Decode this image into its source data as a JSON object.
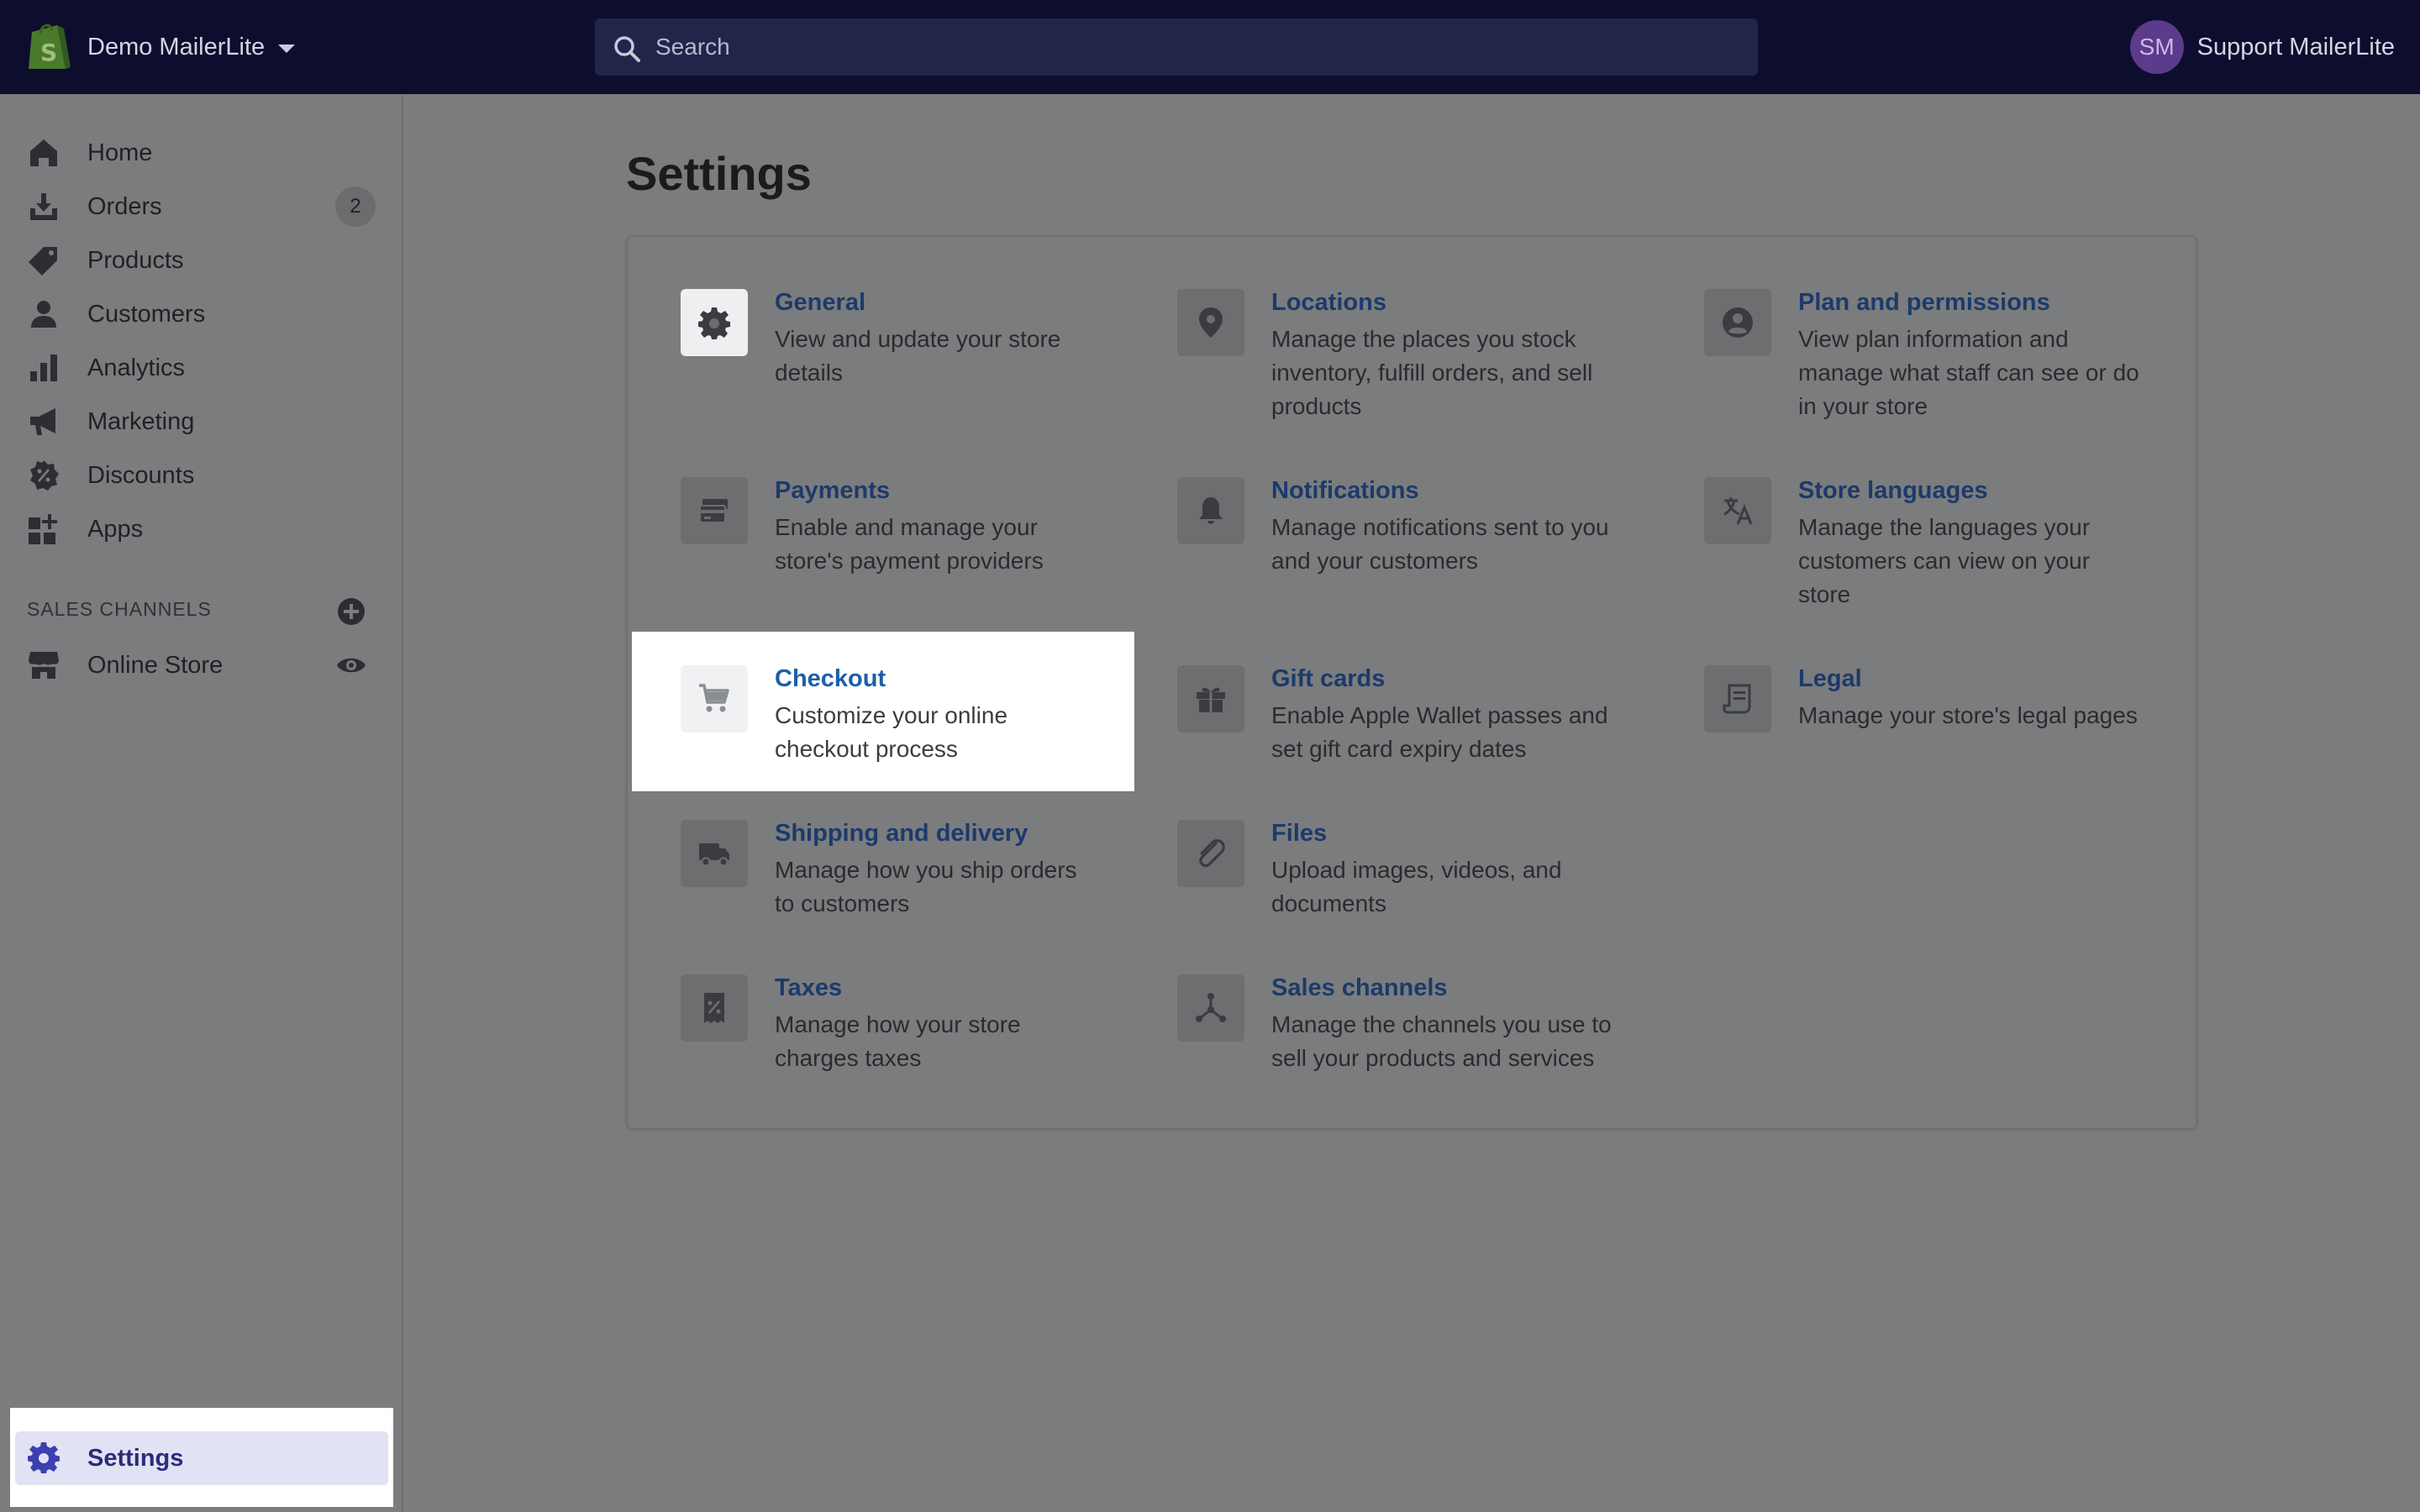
{
  "topbar": {
    "store_name": "Demo MailerLite",
    "search_placeholder": "Search",
    "avatar_initials": "SM",
    "account_name": "Support MailerLite"
  },
  "sidebar": {
    "items": [
      {
        "label": "Home",
        "icon": "home-icon"
      },
      {
        "label": "Orders",
        "icon": "orders-icon",
        "badge": "2"
      },
      {
        "label": "Products",
        "icon": "tag-icon"
      },
      {
        "label": "Customers",
        "icon": "person-icon"
      },
      {
        "label": "Analytics",
        "icon": "bar-chart-icon"
      },
      {
        "label": "Marketing",
        "icon": "megaphone-icon"
      },
      {
        "label": "Discounts",
        "icon": "discount-icon"
      },
      {
        "label": "Apps",
        "icon": "apps-icon"
      }
    ],
    "sales_channels_label": "SALES CHANNELS",
    "channels": [
      {
        "label": "Online Store",
        "icon": "store-icon"
      }
    ],
    "settings_label": "Settings"
  },
  "main": {
    "title": "Settings",
    "tiles": [
      {
        "title": "General",
        "desc": "View and update your store details",
        "icon": "gear-icon"
      },
      {
        "title": "Locations",
        "desc": "Manage the places you stock inventory, fulfill orders, and sell products",
        "icon": "location-pin-icon"
      },
      {
        "title": "Plan and permissions",
        "desc": "View plan information and manage what staff can see or do in your store",
        "icon": "user-circle-icon"
      },
      {
        "title": "Payments",
        "desc": "Enable and manage your store's payment providers",
        "icon": "payment-card-icon"
      },
      {
        "title": "Notifications",
        "desc": "Manage notifications sent to you and your customers",
        "icon": "bell-icon"
      },
      {
        "title": "Store languages",
        "desc": "Manage the languages your customers can view on your store",
        "icon": "translate-icon"
      },
      {
        "title": "Checkout",
        "desc": "Customize your online checkout process",
        "icon": "cart-icon"
      },
      {
        "title": "Gift cards",
        "desc": "Enable Apple Wallet passes and set gift card expiry dates",
        "icon": "gift-icon"
      },
      {
        "title": "Legal",
        "desc": "Manage your store's legal pages",
        "icon": "legal-document-icon"
      },
      {
        "title": "Shipping and delivery",
        "desc": "Manage how you ship orders to customers",
        "icon": "truck-icon"
      },
      {
        "title": "Files",
        "desc": "Upload images, videos, and documents",
        "icon": "paperclip-icon"
      },
      {
        "title": "Taxes",
        "desc": "Manage how your store charges taxes",
        "icon": "tax-receipt-icon"
      },
      {
        "title": "Sales channels",
        "desc": "Manage the channels you use to sell your products and services",
        "icon": "channels-icon"
      }
    ]
  },
  "colors": {
    "topbar_bg": "#0d0e2d",
    "overlay_bg": "#7b7c7d",
    "link": "#1c3a6b",
    "settings_active": "#e1e2f3"
  }
}
